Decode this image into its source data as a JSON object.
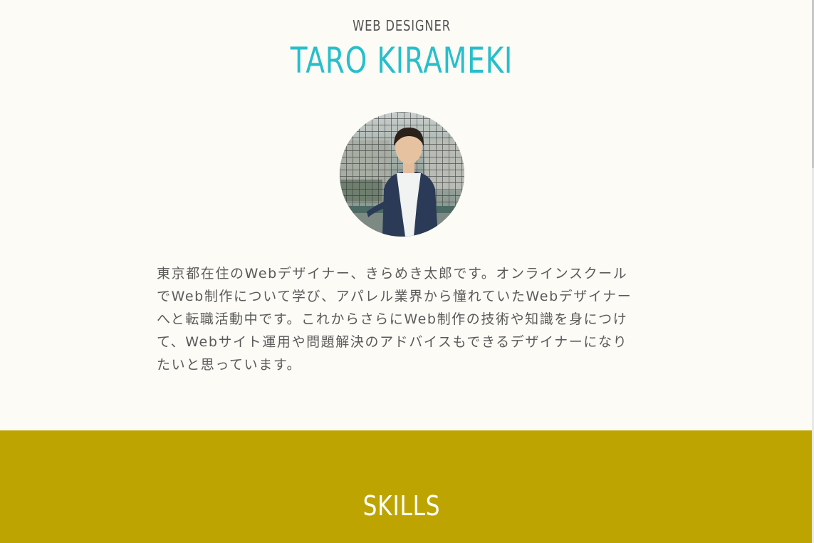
{
  "header": {
    "role": "WEB DESIGNER",
    "name": "TARO KIRAMEKI"
  },
  "profile": {
    "bio": "東京都在住のWebデザイナー、きらめき太郎です。オンラインスクールでWeb制作について学び、アパレル業界から憧れていたWebデザイナーへと転職活動中です。これからさらにWeb制作の技術や知識を身につけて、Webサイト運用や問題解決のアドバイスもできるデザイナーになりたいと思っています。"
  },
  "skills": {
    "title": "SKILLS"
  },
  "colors": {
    "accent": "#26bfcb",
    "band": "#bda400",
    "background": "#fcfbf6"
  }
}
